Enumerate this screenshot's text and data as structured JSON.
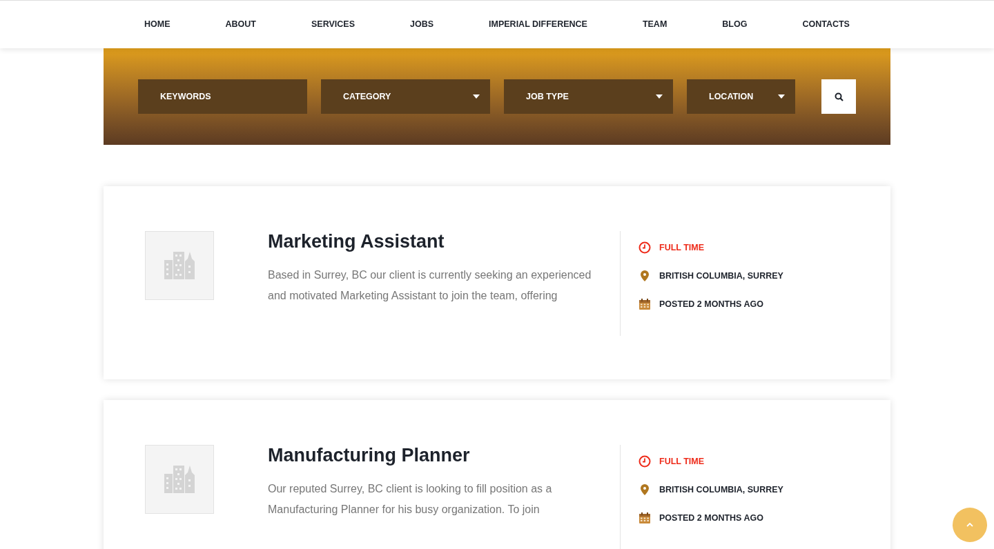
{
  "nav": {
    "items": [
      {
        "label": "HOME"
      },
      {
        "label": "ABOUT"
      },
      {
        "label": "SERVICES"
      },
      {
        "label": "JOBS"
      },
      {
        "label": "IMPERIAL DIFFERENCE"
      },
      {
        "label": "TEAM"
      },
      {
        "label": "BLOG"
      },
      {
        "label": "CONTACTS"
      }
    ]
  },
  "search": {
    "keywords": {
      "placeholder": "KEYWORDS"
    },
    "dropdowns": [
      {
        "label": "CATEGORY"
      },
      {
        "label": "JOB TYPE"
      },
      {
        "label": "LOCATION"
      }
    ]
  },
  "jobs": [
    {
      "title": "Marketing Assistant",
      "description": "Based in Surrey, BC our client is currently seeking an experienced and motivated Marketing Assistant to join the team, offering",
      "type": "FULL TIME",
      "location": "BRITISH COLUMBIA, SURREY",
      "posted": "POSTED 2 MONTHS AGO"
    },
    {
      "title": "Manufacturing Planner",
      "description": "Our reputed Surrey, BC client is looking to fill position as a Manufacturing Planner for his busy organization. To join",
      "type": "FULL TIME",
      "location": "BRITISH COLUMBIA, SURREY",
      "posted": "POSTED 2 MONTHS AGO"
    }
  ]
}
